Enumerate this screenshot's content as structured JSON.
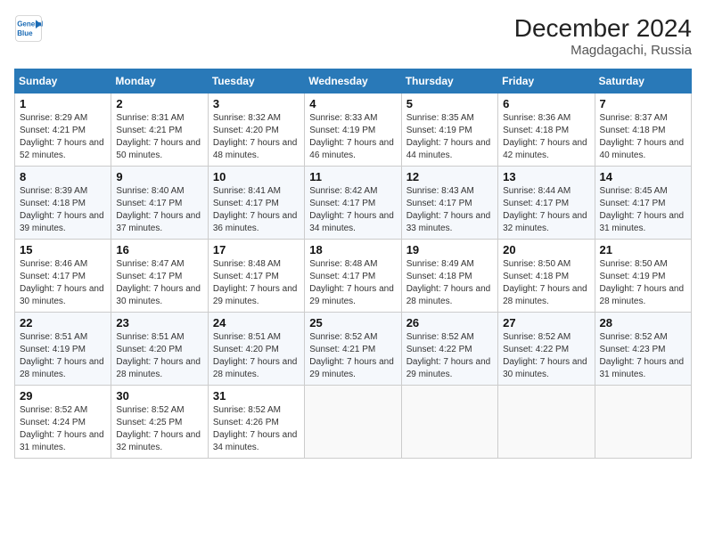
{
  "header": {
    "logo_line1": "General",
    "logo_line2": "Blue",
    "title": "December 2024",
    "subtitle": "Magdagachi, Russia"
  },
  "columns": [
    "Sunday",
    "Monday",
    "Tuesday",
    "Wednesday",
    "Thursday",
    "Friday",
    "Saturday"
  ],
  "weeks": [
    [
      {
        "day": "1",
        "sunrise": "Sunrise: 8:29 AM",
        "sunset": "Sunset: 4:21 PM",
        "daylight": "Daylight: 7 hours and 52 minutes."
      },
      {
        "day": "2",
        "sunrise": "Sunrise: 8:31 AM",
        "sunset": "Sunset: 4:21 PM",
        "daylight": "Daylight: 7 hours and 50 minutes."
      },
      {
        "day": "3",
        "sunrise": "Sunrise: 8:32 AM",
        "sunset": "Sunset: 4:20 PM",
        "daylight": "Daylight: 7 hours and 48 minutes."
      },
      {
        "day": "4",
        "sunrise": "Sunrise: 8:33 AM",
        "sunset": "Sunset: 4:19 PM",
        "daylight": "Daylight: 7 hours and 46 minutes."
      },
      {
        "day": "5",
        "sunrise": "Sunrise: 8:35 AM",
        "sunset": "Sunset: 4:19 PM",
        "daylight": "Daylight: 7 hours and 44 minutes."
      },
      {
        "day": "6",
        "sunrise": "Sunrise: 8:36 AM",
        "sunset": "Sunset: 4:18 PM",
        "daylight": "Daylight: 7 hours and 42 minutes."
      },
      {
        "day": "7",
        "sunrise": "Sunrise: 8:37 AM",
        "sunset": "Sunset: 4:18 PM",
        "daylight": "Daylight: 7 hours and 40 minutes."
      }
    ],
    [
      {
        "day": "8",
        "sunrise": "Sunrise: 8:39 AM",
        "sunset": "Sunset: 4:18 PM",
        "daylight": "Daylight: 7 hours and 39 minutes."
      },
      {
        "day": "9",
        "sunrise": "Sunrise: 8:40 AM",
        "sunset": "Sunset: 4:17 PM",
        "daylight": "Daylight: 7 hours and 37 minutes."
      },
      {
        "day": "10",
        "sunrise": "Sunrise: 8:41 AM",
        "sunset": "Sunset: 4:17 PM",
        "daylight": "Daylight: 7 hours and 36 minutes."
      },
      {
        "day": "11",
        "sunrise": "Sunrise: 8:42 AM",
        "sunset": "Sunset: 4:17 PM",
        "daylight": "Daylight: 7 hours and 34 minutes."
      },
      {
        "day": "12",
        "sunrise": "Sunrise: 8:43 AM",
        "sunset": "Sunset: 4:17 PM",
        "daylight": "Daylight: 7 hours and 33 minutes."
      },
      {
        "day": "13",
        "sunrise": "Sunrise: 8:44 AM",
        "sunset": "Sunset: 4:17 PM",
        "daylight": "Daylight: 7 hours and 32 minutes."
      },
      {
        "day": "14",
        "sunrise": "Sunrise: 8:45 AM",
        "sunset": "Sunset: 4:17 PM",
        "daylight": "Daylight: 7 hours and 31 minutes."
      }
    ],
    [
      {
        "day": "15",
        "sunrise": "Sunrise: 8:46 AM",
        "sunset": "Sunset: 4:17 PM",
        "daylight": "Daylight: 7 hours and 30 minutes."
      },
      {
        "day": "16",
        "sunrise": "Sunrise: 8:47 AM",
        "sunset": "Sunset: 4:17 PM",
        "daylight": "Daylight: 7 hours and 30 minutes."
      },
      {
        "day": "17",
        "sunrise": "Sunrise: 8:48 AM",
        "sunset": "Sunset: 4:17 PM",
        "daylight": "Daylight: 7 hours and 29 minutes."
      },
      {
        "day": "18",
        "sunrise": "Sunrise: 8:48 AM",
        "sunset": "Sunset: 4:17 PM",
        "daylight": "Daylight: 7 hours and 29 minutes."
      },
      {
        "day": "19",
        "sunrise": "Sunrise: 8:49 AM",
        "sunset": "Sunset: 4:18 PM",
        "daylight": "Daylight: 7 hours and 28 minutes."
      },
      {
        "day": "20",
        "sunrise": "Sunrise: 8:50 AM",
        "sunset": "Sunset: 4:18 PM",
        "daylight": "Daylight: 7 hours and 28 minutes."
      },
      {
        "day": "21",
        "sunrise": "Sunrise: 8:50 AM",
        "sunset": "Sunset: 4:19 PM",
        "daylight": "Daylight: 7 hours and 28 minutes."
      }
    ],
    [
      {
        "day": "22",
        "sunrise": "Sunrise: 8:51 AM",
        "sunset": "Sunset: 4:19 PM",
        "daylight": "Daylight: 7 hours and 28 minutes."
      },
      {
        "day": "23",
        "sunrise": "Sunrise: 8:51 AM",
        "sunset": "Sunset: 4:20 PM",
        "daylight": "Daylight: 7 hours and 28 minutes."
      },
      {
        "day": "24",
        "sunrise": "Sunrise: 8:51 AM",
        "sunset": "Sunset: 4:20 PM",
        "daylight": "Daylight: 7 hours and 28 minutes."
      },
      {
        "day": "25",
        "sunrise": "Sunrise: 8:52 AM",
        "sunset": "Sunset: 4:21 PM",
        "daylight": "Daylight: 7 hours and 29 minutes."
      },
      {
        "day": "26",
        "sunrise": "Sunrise: 8:52 AM",
        "sunset": "Sunset: 4:22 PM",
        "daylight": "Daylight: 7 hours and 29 minutes."
      },
      {
        "day": "27",
        "sunrise": "Sunrise: 8:52 AM",
        "sunset": "Sunset: 4:22 PM",
        "daylight": "Daylight: 7 hours and 30 minutes."
      },
      {
        "day": "28",
        "sunrise": "Sunrise: 8:52 AM",
        "sunset": "Sunset: 4:23 PM",
        "daylight": "Daylight: 7 hours and 31 minutes."
      }
    ],
    [
      {
        "day": "29",
        "sunrise": "Sunrise: 8:52 AM",
        "sunset": "Sunset: 4:24 PM",
        "daylight": "Daylight: 7 hours and 31 minutes."
      },
      {
        "day": "30",
        "sunrise": "Sunrise: 8:52 AM",
        "sunset": "Sunset: 4:25 PM",
        "daylight": "Daylight: 7 hours and 32 minutes."
      },
      {
        "day": "31",
        "sunrise": "Sunrise: 8:52 AM",
        "sunset": "Sunset: 4:26 PM",
        "daylight": "Daylight: 7 hours and 34 minutes."
      },
      null,
      null,
      null,
      null
    ]
  ]
}
